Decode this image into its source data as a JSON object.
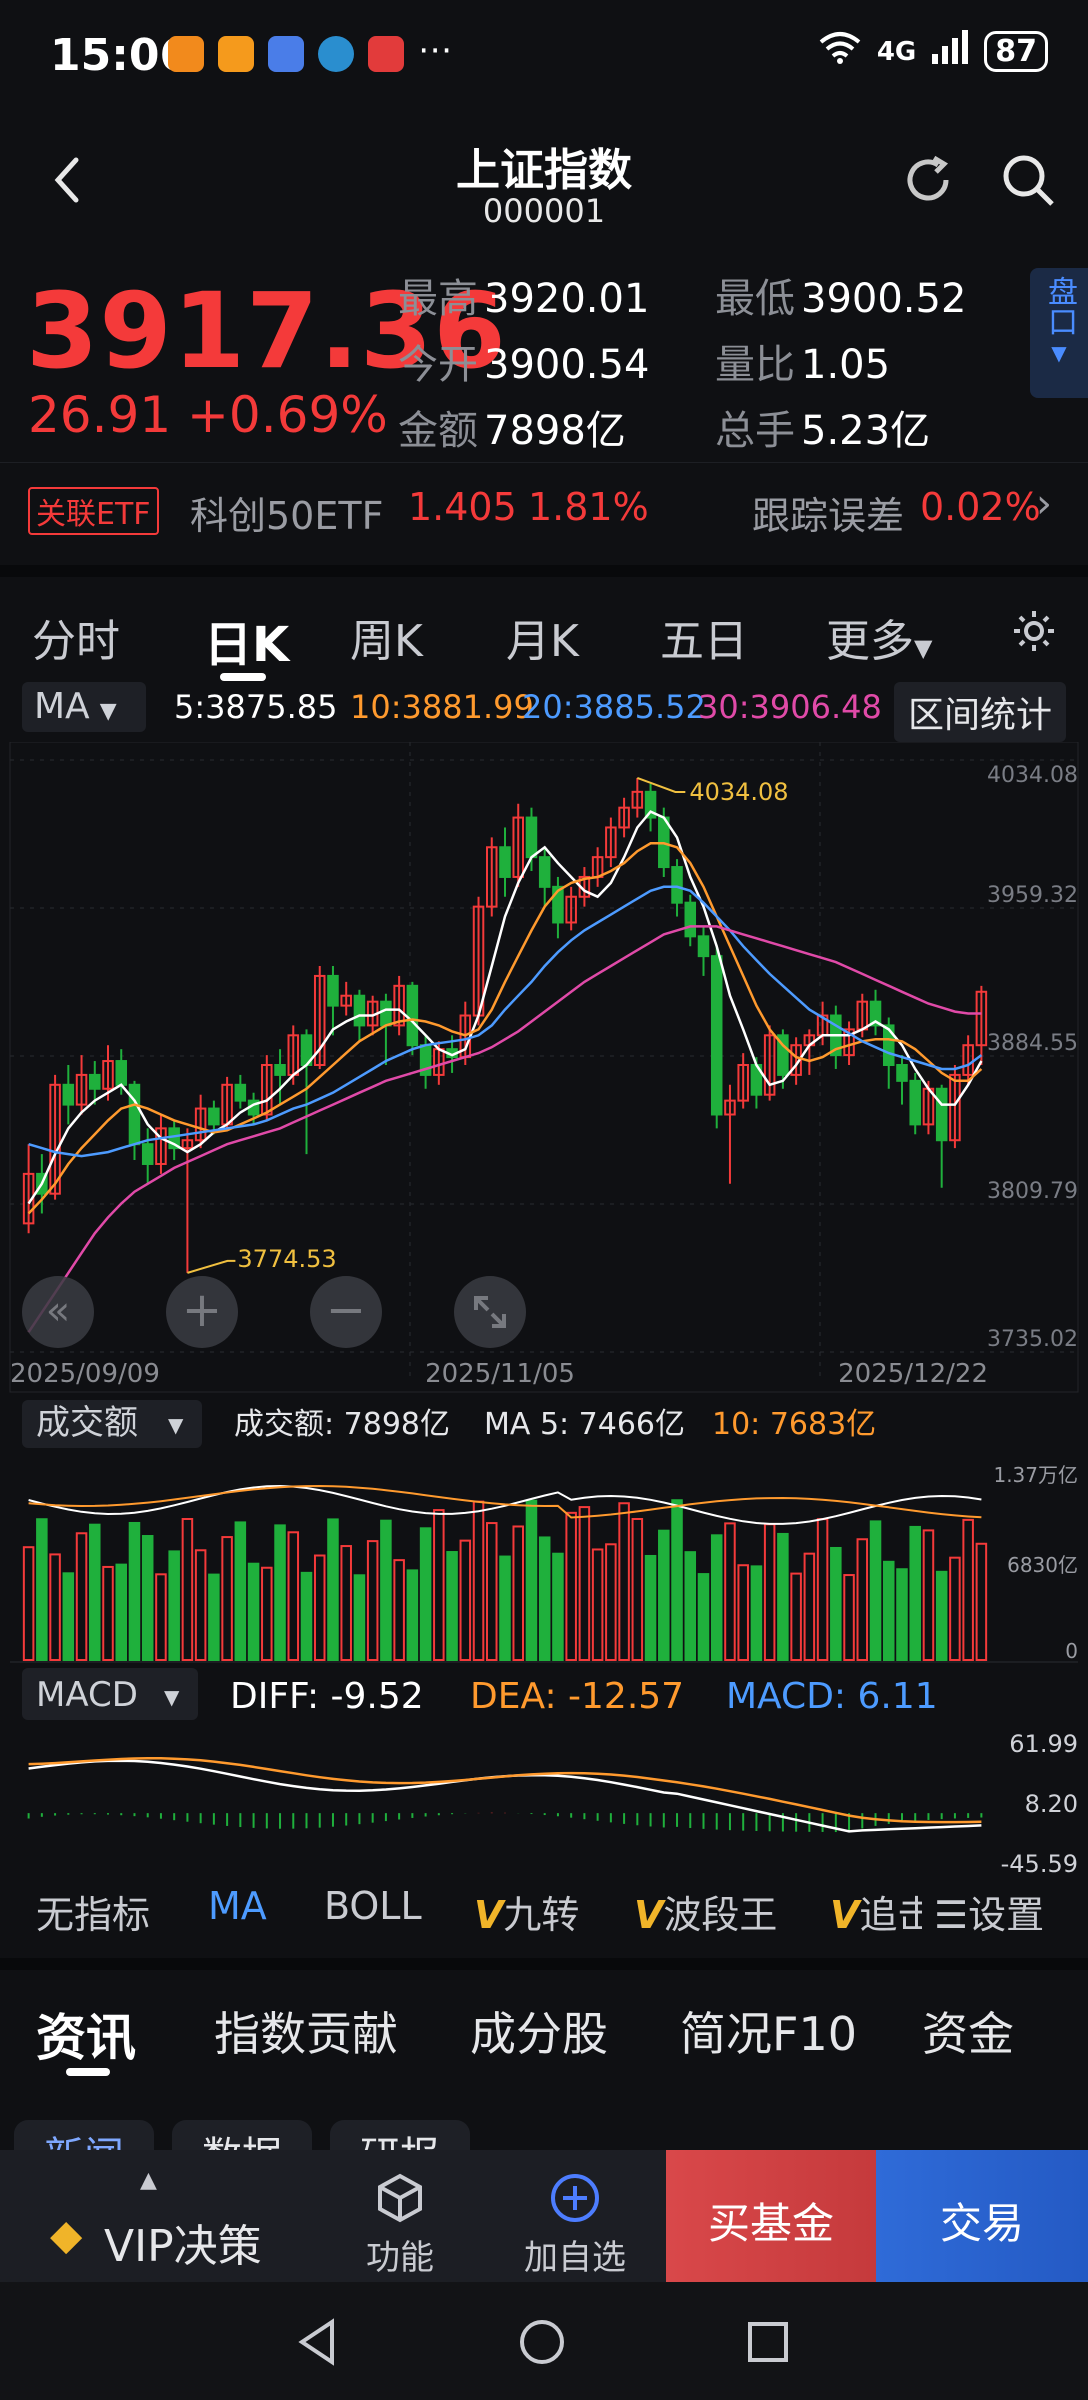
{
  "status_bar": {
    "time": "15:06",
    "signal": "4G",
    "battery": "87"
  },
  "header": {
    "title": "上证指数",
    "code": "000001"
  },
  "quote": {
    "price": "3917.36",
    "change": "26.91 +0.69%",
    "stats": [
      {
        "label": "最高",
        "value": "3920.01"
      },
      {
        "label": "最低",
        "value": "3900.52"
      },
      {
        "label": "今开",
        "value": "3900.54"
      },
      {
        "label": "量比",
        "value": "1.05"
      },
      {
        "label": "金额",
        "value": "7898亿"
      },
      {
        "label": "总手",
        "value": "5.23亿"
      }
    ],
    "panko_label": "盘口"
  },
  "etf": {
    "tag": "关联ETF",
    "name": "科创50ETF",
    "price": "1.405",
    "pct": "1.81%",
    "tracking_label": "跟踪误差",
    "tracking_value": "0.02%"
  },
  "chart_tabs": [
    "分时",
    "日K",
    "周K",
    "月K",
    "五日",
    "更多"
  ],
  "active_chart_tab": "日K",
  "ma_bar": {
    "selector": "MA",
    "ma5": "5:3875.85",
    "ma10": "10:3881.99",
    "ma20": "20:3885.52",
    "ma30": "30:3906.48",
    "range_button": "区间统计"
  },
  "colors": {
    "up": "#f43a3a",
    "down": "#1fb03c",
    "ma5": "#ffffff",
    "ma10": "#ff9a2e",
    "ma20": "#4d9bff",
    "ma30": "#e04aa8",
    "label_yellow": "#f0c040"
  },
  "chart_data": [
    {
      "type": "candlestick",
      "y_axis_labels": [
        "4034.08",
        "3959.32",
        "3884.55",
        "3809.79",
        "3735.02"
      ],
      "ylim": [
        3735.02,
        4034.08
      ],
      "x_labels": [
        "2025/09/09",
        "2025/11/05",
        "2025/12/22"
      ],
      "high_annotation": "4034.08",
      "low_annotation": "3774.53",
      "candles": [
        [
          3800,
          3825,
          3795,
          3840
        ],
        [
          3825,
          3815,
          3805,
          3835
        ],
        [
          3815,
          3870,
          3812,
          3875
        ],
        [
          3870,
          3860,
          3850,
          3880
        ],
        [
          3860,
          3875,
          3855,
          3885
        ],
        [
          3875,
          3868,
          3860,
          3882
        ],
        [
          3868,
          3882,
          3862,
          3890
        ],
        [
          3882,
          3870,
          3865,
          3888
        ],
        [
          3870,
          3840,
          3832,
          3872
        ],
        [
          3840,
          3830,
          3820,
          3848
        ],
        [
          3830,
          3848,
          3825,
          3855
        ],
        [
          3848,
          3838,
          3832,
          3852
        ],
        [
          3838,
          3842,
          3775,
          3848
        ],
        [
          3842,
          3858,
          3838,
          3865
        ],
        [
          3858,
          3850,
          3845,
          3862
        ],
        [
          3850,
          3870,
          3848,
          3874
        ],
        [
          3870,
          3862,
          3858,
          3875
        ],
        [
          3862,
          3855,
          3850,
          3866
        ],
        [
          3855,
          3880,
          3852,
          3885
        ],
        [
          3880,
          3875,
          3860,
          3888
        ],
        [
          3875,
          3895,
          3870,
          3900
        ],
        [
          3895,
          3880,
          3835,
          3898
        ],
        [
          3880,
          3925,
          3878,
          3930
        ],
        [
          3925,
          3910,
          3895,
          3930
        ],
        [
          3910,
          3915,
          3905,
          3922
        ],
        [
          3915,
          3900,
          3892,
          3918
        ],
        [
          3900,
          3912,
          3895,
          3915
        ],
        [
          3912,
          3900,
          3880,
          3916
        ],
        [
          3900,
          3920,
          3895,
          3925
        ],
        [
          3920,
          3890,
          3885,
          3922
        ],
        [
          3890,
          3875,
          3868,
          3895
        ],
        [
          3875,
          3888,
          3870,
          3892
        ],
        [
          3888,
          3884,
          3876,
          3895
        ],
        [
          3884,
          3905,
          3880,
          3912
        ],
        [
          3905,
          3960,
          3900,
          3965
        ],
        [
          3960,
          3990,
          3955,
          3995
        ],
        [
          3990,
          3975,
          3965,
          4000
        ],
        [
          3975,
          4005,
          3970,
          4012
        ],
        [
          4005,
          3985,
          3978,
          4010
        ],
        [
          3985,
          3970,
          3960,
          3990
        ],
        [
          3970,
          3952,
          3944,
          3975
        ],
        [
          3952,
          3965,
          3948,
          3970
        ],
        [
          3965,
          3975,
          3960,
          3980
        ],
        [
          3975,
          3985,
          3970,
          3990
        ],
        [
          3985,
          4000,
          3980,
          4005
        ],
        [
          4000,
          4010,
          3995,
          4015
        ],
        [
          4010,
          4018,
          4005,
          4025
        ],
        [
          4018,
          4005,
          3998,
          4022
        ],
        [
          4005,
          3980,
          3975,
          4010
        ],
        [
          3980,
          3962,
          3955,
          3984
        ],
        [
          3962,
          3945,
          3940,
          3966
        ],
        [
          3945,
          3935,
          3925,
          3950
        ],
        [
          3935,
          3855,
          3848,
          3940
        ],
        [
          3855,
          3862,
          3820,
          3870
        ],
        [
          3862,
          3880,
          3858,
          3886
        ],
        [
          3880,
          3865,
          3858,
          3884
        ],
        [
          3865,
          3895,
          3862,
          3900
        ],
        [
          3895,
          3875,
          3868,
          3898
        ],
        [
          3875,
          3890,
          3870,
          3894
        ],
        [
          3890,
          3895,
          3875,
          3898
        ],
        [
          3895,
          3905,
          3890,
          3912
        ],
        [
          3905,
          3885,
          3878,
          3910
        ],
        [
          3885,
          3898,
          3880,
          3902
        ],
        [
          3898,
          3912,
          3894,
          3916
        ],
        [
          3912,
          3900,
          3895,
          3918
        ],
        [
          3900,
          3880,
          3868,
          3904
        ],
        [
          3880,
          3872,
          3860,
          3885
        ],
        [
          3872,
          3850,
          3845,
          3876
        ],
        [
          3850,
          3868,
          3845,
          3872
        ],
        [
          3868,
          3842,
          3818,
          3870
        ],
        [
          3842,
          3875,
          3838,
          3880
        ],
        [
          3875,
          3890,
          3870,
          3895
        ],
        [
          3890,
          3917,
          3880,
          3920
        ]
      ],
      "ma5": [
        3810,
        3820,
        3835,
        3848,
        3856,
        3862,
        3866,
        3870,
        3862,
        3850,
        3843,
        3840,
        3836,
        3840,
        3846,
        3850,
        3856,
        3860,
        3862,
        3868,
        3875,
        3880,
        3888,
        3898,
        3902,
        3905,
        3905,
        3908,
        3908,
        3902,
        3895,
        3888,
        3885,
        3888,
        3905,
        3930,
        3955,
        3972,
        3985,
        3990,
        3982,
        3975,
        3968,
        3965,
        3972,
        3985,
        4000,
        4008,
        4005,
        3995,
        3975,
        3960,
        3940,
        3915,
        3898,
        3880,
        3870,
        3872,
        3880,
        3890,
        3895,
        3895,
        3895,
        3898,
        3902,
        3898,
        3890,
        3878,
        3868,
        3860,
        3860,
        3870,
        3882
      ],
      "ma10": [
        3805,
        3812,
        3820,
        3830,
        3838,
        3845,
        3852,
        3858,
        3860,
        3858,
        3855,
        3852,
        3850,
        3848,
        3846,
        3847,
        3850,
        3853,
        3856,
        3860,
        3864,
        3868,
        3874,
        3880,
        3886,
        3892,
        3896,
        3900,
        3902,
        3903,
        3902,
        3900,
        3897,
        3895,
        3898,
        3908,
        3922,
        3935,
        3948,
        3960,
        3968,
        3972,
        3974,
        3975,
        3978,
        3982,
        3988,
        3992,
        3992,
        3990,
        3982,
        3970,
        3955,
        3940,
        3925,
        3910,
        3898,
        3890,
        3884,
        3882,
        3884,
        3888,
        3890,
        3892,
        3893,
        3893,
        3892,
        3888,
        3882,
        3876,
        3872,
        3872,
        3878
      ],
      "ma20": [
        3840,
        3838,
        3836,
        3835,
        3834,
        3835,
        3836,
        3838,
        3840,
        3842,
        3843,
        3844,
        3845,
        3846,
        3847,
        3848,
        3849,
        3850,
        3852,
        3855,
        3858,
        3860,
        3863,
        3866,
        3870,
        3874,
        3878,
        3882,
        3885,
        3888,
        3890,
        3891,
        3892,
        3893,
        3895,
        3900,
        3908,
        3915,
        3922,
        3930,
        3937,
        3943,
        3948,
        3952,
        3956,
        3960,
        3964,
        3968,
        3970,
        3970,
        3968,
        3962,
        3955,
        3948,
        3940,
        3933,
        3926,
        3920,
        3914,
        3908,
        3904,
        3900,
        3896,
        3892,
        3889,
        3886,
        3884,
        3882,
        3880,
        3878,
        3878,
        3880,
        3885
      ],
      "ma30": [
        3745,
        3755,
        3765,
        3775,
        3785,
        3795,
        3803,
        3810,
        3816,
        3820,
        3824,
        3828,
        3831,
        3834,
        3837,
        3840,
        3842,
        3844,
        3846,
        3848,
        3851,
        3854,
        3857,
        3860,
        3863,
        3866,
        3869,
        3872,
        3874,
        3876,
        3878,
        3880,
        3882,
        3884,
        3886,
        3889,
        3893,
        3897,
        3902,
        3907,
        3912,
        3917,
        3922,
        3926,
        3930,
        3934,
        3938,
        3942,
        3946,
        3948,
        3950,
        3950,
        3950,
        3948,
        3946,
        3944,
        3942,
        3940,
        3938,
        3936,
        3934,
        3932,
        3929,
        3926,
        3923,
        3920,
        3917,
        3914,
        3911,
        3909,
        3907,
        3906,
        3906
      ]
    },
    {
      "type": "bar",
      "title": "成交额",
      "labels": {
        "value": "成交额: 7898亿",
        "ma5": "MA 5: 7466亿",
        "ma10": "10: 7683亿"
      },
      "y_axis_labels": [
        "1.37万亿",
        "6830亿",
        "0"
      ],
      "ylim": [
        0,
        13700
      ]
    },
    {
      "type": "macd",
      "title": "MACD",
      "labels": {
        "diff": "DIFF: -9.52",
        "dea": "DEA: -12.57",
        "macd": "MACD: 6.11"
      },
      "y_axis_labels": [
        "61.99",
        "8.20",
        "-45.59"
      ],
      "ylim": [
        -45.59,
        61.99
      ]
    }
  ],
  "indicator_buttons": [
    "无指标",
    "MA",
    "BOLL",
    "九转",
    "波段王",
    "追击"
  ],
  "settings_label": "设置",
  "bottom_tabs": [
    "资讯",
    "指数贡献",
    "成分股",
    "简况F10",
    "资金"
  ],
  "sub_tabs": [
    "新闻",
    "数据",
    "研报"
  ],
  "footer": {
    "vip": "VIP决策",
    "func": "功能",
    "watch": "加自选",
    "buy": "买基金",
    "trade": "交易"
  }
}
